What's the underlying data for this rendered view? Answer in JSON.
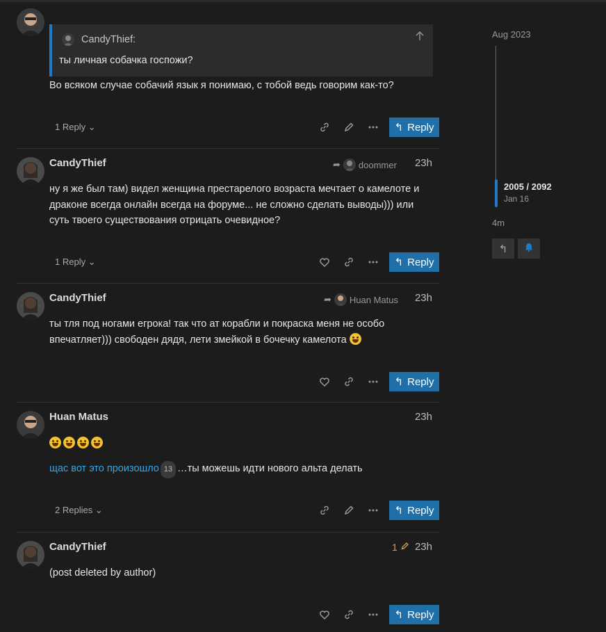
{
  "colors": {
    "accent": "#1f6fa8",
    "link": "#3ba3e0",
    "background": "#1c1c1c"
  },
  "posts": [
    {
      "username": "",
      "quote": {
        "author": "CandyThief:",
        "text": "ты личная собачка госпожи?"
      },
      "body": "Во всяком случае собачий язык я понимаю, с тобой ведь говорим как-то?",
      "replies_label": "1 Reply",
      "reply_label": "Reply"
    },
    {
      "username": "CandyThief",
      "reply_to": "doommer",
      "time": "23h",
      "body": "ну я же был там) видел женщина престарелого возраста мечтает о камелоте и драконе всегда онлайн всегда на форуме... не сложно сделать выводы))) или суть твоего существования отрицать очевидное?",
      "replies_label": "1 Reply",
      "reply_label": "Reply"
    },
    {
      "username": "CandyThief",
      "reply_to": "Huan Matus",
      "time": "23h",
      "body": "ты тля под ногами егрока! так что ат корабли и покраска меня не особо впечатляет))) свободен дядя, лети змейкой в бочечку камелота",
      "reply_label": "Reply"
    },
    {
      "username": "Huan Matus",
      "time": "23h",
      "link_text": "щас вот это произошло",
      "link_count": "13",
      "after_link": "…ты можешь идти нового альта делать",
      "replies_label": "2 Replies",
      "reply_label": "Reply"
    },
    {
      "username": "CandyThief",
      "edits": "1",
      "time": "23h",
      "body": "(post deleted by author)",
      "reply_label": "Reply"
    }
  ],
  "timeline": {
    "start": "Aug 2023",
    "position": "2005 / 2092",
    "date": "Jan 16",
    "end": "4m",
    "progress_fraction": 0.958
  }
}
